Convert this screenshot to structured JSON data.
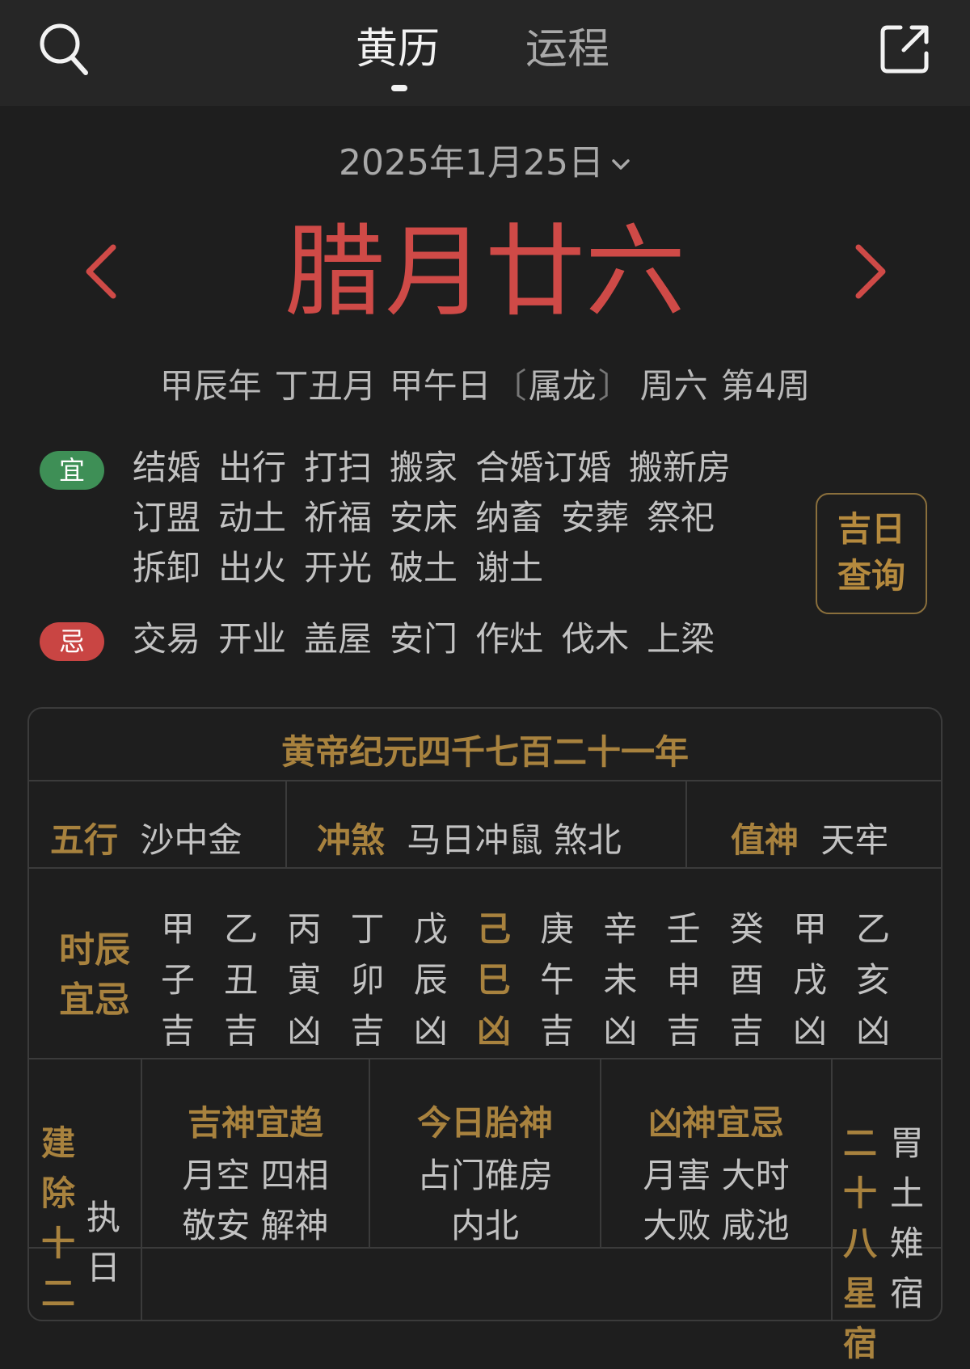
{
  "header": {
    "tabs": [
      {
        "label": "黄历",
        "active": true
      },
      {
        "label": "运程",
        "active": false
      }
    ],
    "icons": [
      "search-icon",
      "share-icon"
    ]
  },
  "date": {
    "solar": "2025年1月25日",
    "lunar": "腊月廿六",
    "ganzhi_year": "甲辰年",
    "ganzhi_month": "丁丑月",
    "ganzhi_day": "甲午日",
    "zodiac": "属龙",
    "weekday": "周六",
    "week": "第4周"
  },
  "yi": {
    "badge": "宜",
    "items": [
      "结婚",
      "出行",
      "打扫",
      "搬家",
      "合婚订婚",
      "搬新房",
      "订盟",
      "动土",
      "祈福",
      "安床",
      "纳畜",
      "安葬",
      "祭祀",
      "拆卸",
      "出火",
      "开光",
      "破土",
      "谢土"
    ]
  },
  "ji": {
    "badge": "忌",
    "items": [
      "交易",
      "开业",
      "盖屋",
      "安门",
      "作灶",
      "伐木",
      "上梁"
    ]
  },
  "jiri_button": {
    "line1": "吉日",
    "line2": "查询"
  },
  "panel": {
    "title": "黄帝纪元四千七百二十一年",
    "wuxing": {
      "label": "五行",
      "value": "沙中金"
    },
    "chongsha": {
      "label": "冲煞",
      "value": "马日冲鼠 煞北"
    },
    "zhishen": {
      "label": "值神",
      "value": "天牢"
    },
    "shichen": {
      "label1": "时辰",
      "label2": "宜忌",
      "hours": [
        {
          "gan": "甲",
          "zhi": "子",
          "luck": "吉",
          "active": false
        },
        {
          "gan": "乙",
          "zhi": "丑",
          "luck": "吉",
          "active": false
        },
        {
          "gan": "丙",
          "zhi": "寅",
          "luck": "凶",
          "active": false
        },
        {
          "gan": "丁",
          "zhi": "卯",
          "luck": "吉",
          "active": false
        },
        {
          "gan": "戊",
          "zhi": "辰",
          "luck": "凶",
          "active": false
        },
        {
          "gan": "己",
          "zhi": "巳",
          "luck": "凶",
          "active": true
        },
        {
          "gan": "庚",
          "zhi": "午",
          "luck": "吉",
          "active": false
        },
        {
          "gan": "辛",
          "zhi": "未",
          "luck": "凶",
          "active": false
        },
        {
          "gan": "壬",
          "zhi": "申",
          "luck": "吉",
          "active": false
        },
        {
          "gan": "癸",
          "zhi": "酉",
          "luck": "吉",
          "active": false
        },
        {
          "gan": "甲",
          "zhi": "戌",
          "luck": "凶",
          "active": false
        },
        {
          "gan": "乙",
          "zhi": "亥",
          "luck": "凶",
          "active": false
        }
      ]
    },
    "jianchu": {
      "label": "建除十二",
      "value": "执日"
    },
    "jishen": {
      "title": "吉神宜趋",
      "line1": "月空 四相",
      "line2": "敬安 解神"
    },
    "taishen": {
      "title": "今日胎神",
      "line1": "占门碓房",
      "line2": "内北"
    },
    "xiongshen": {
      "title": "凶神宜忌",
      "line1": "月害 大时",
      "line2": "大败 咸池"
    },
    "xiu": {
      "label": "二十八星宿",
      "value": "胃土雉宿"
    }
  }
}
